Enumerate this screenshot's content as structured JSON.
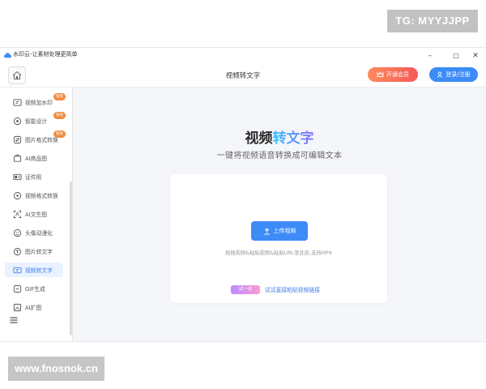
{
  "overlay": {
    "tg_text": "TG: MYYJJPP",
    "watermark_text": "www.fnosnok.cn"
  },
  "window": {
    "title": "水印云-让素材处理更简单",
    "minimize": "–",
    "maximize": "□",
    "close": "✕"
  },
  "header": {
    "title": "视频转文字",
    "vip_label": "开通会员",
    "login_label": "登录/注册"
  },
  "sidebar": {
    "items": [
      {
        "label": "视频加水印",
        "icon": "video-watermark-icon",
        "badge": "限免"
      },
      {
        "label": "智能设计",
        "icon": "design-icon",
        "badge": "限免"
      },
      {
        "label": "图片格式转换",
        "icon": "image-convert-icon",
        "badge": "限免"
      },
      {
        "label": "AI商品图",
        "icon": "product-image-icon",
        "badge": ""
      },
      {
        "label": "证件照",
        "icon": "id-photo-icon",
        "badge": ""
      },
      {
        "label": "视频格式转换",
        "icon": "video-convert-icon",
        "badge": ""
      },
      {
        "label": "AI文生图",
        "icon": "text-to-image-icon",
        "badge": ""
      },
      {
        "label": "头像动漫化",
        "icon": "avatar-anime-icon",
        "badge": ""
      },
      {
        "label": "图片转文字",
        "icon": "image-to-text-icon",
        "badge": ""
      },
      {
        "label": "视频转文字",
        "icon": "video-to-text-icon",
        "badge": "",
        "active": true
      },
      {
        "label": "GIF生成",
        "icon": "gif-icon",
        "badge": ""
      },
      {
        "label": "AI扩图",
        "icon": "ai-expand-icon",
        "badge": ""
      }
    ]
  },
  "main": {
    "hero_title_part1": "视频",
    "hero_title_part2": "转文字",
    "subtitle": "一键将视频语音转换成可编辑文本",
    "upload_label": "上传视频",
    "hint": "拖拽视频&粘贴视频&粘贴URL至此处,支持MP4",
    "try_tag": "试一试",
    "try_link": "试试直接粘贴视频链接"
  },
  "colors": {
    "accent": "#3d8bf7",
    "vip": "#f65a5a",
    "badge": "#f28a3c",
    "active_bg": "#eaf2ff"
  }
}
